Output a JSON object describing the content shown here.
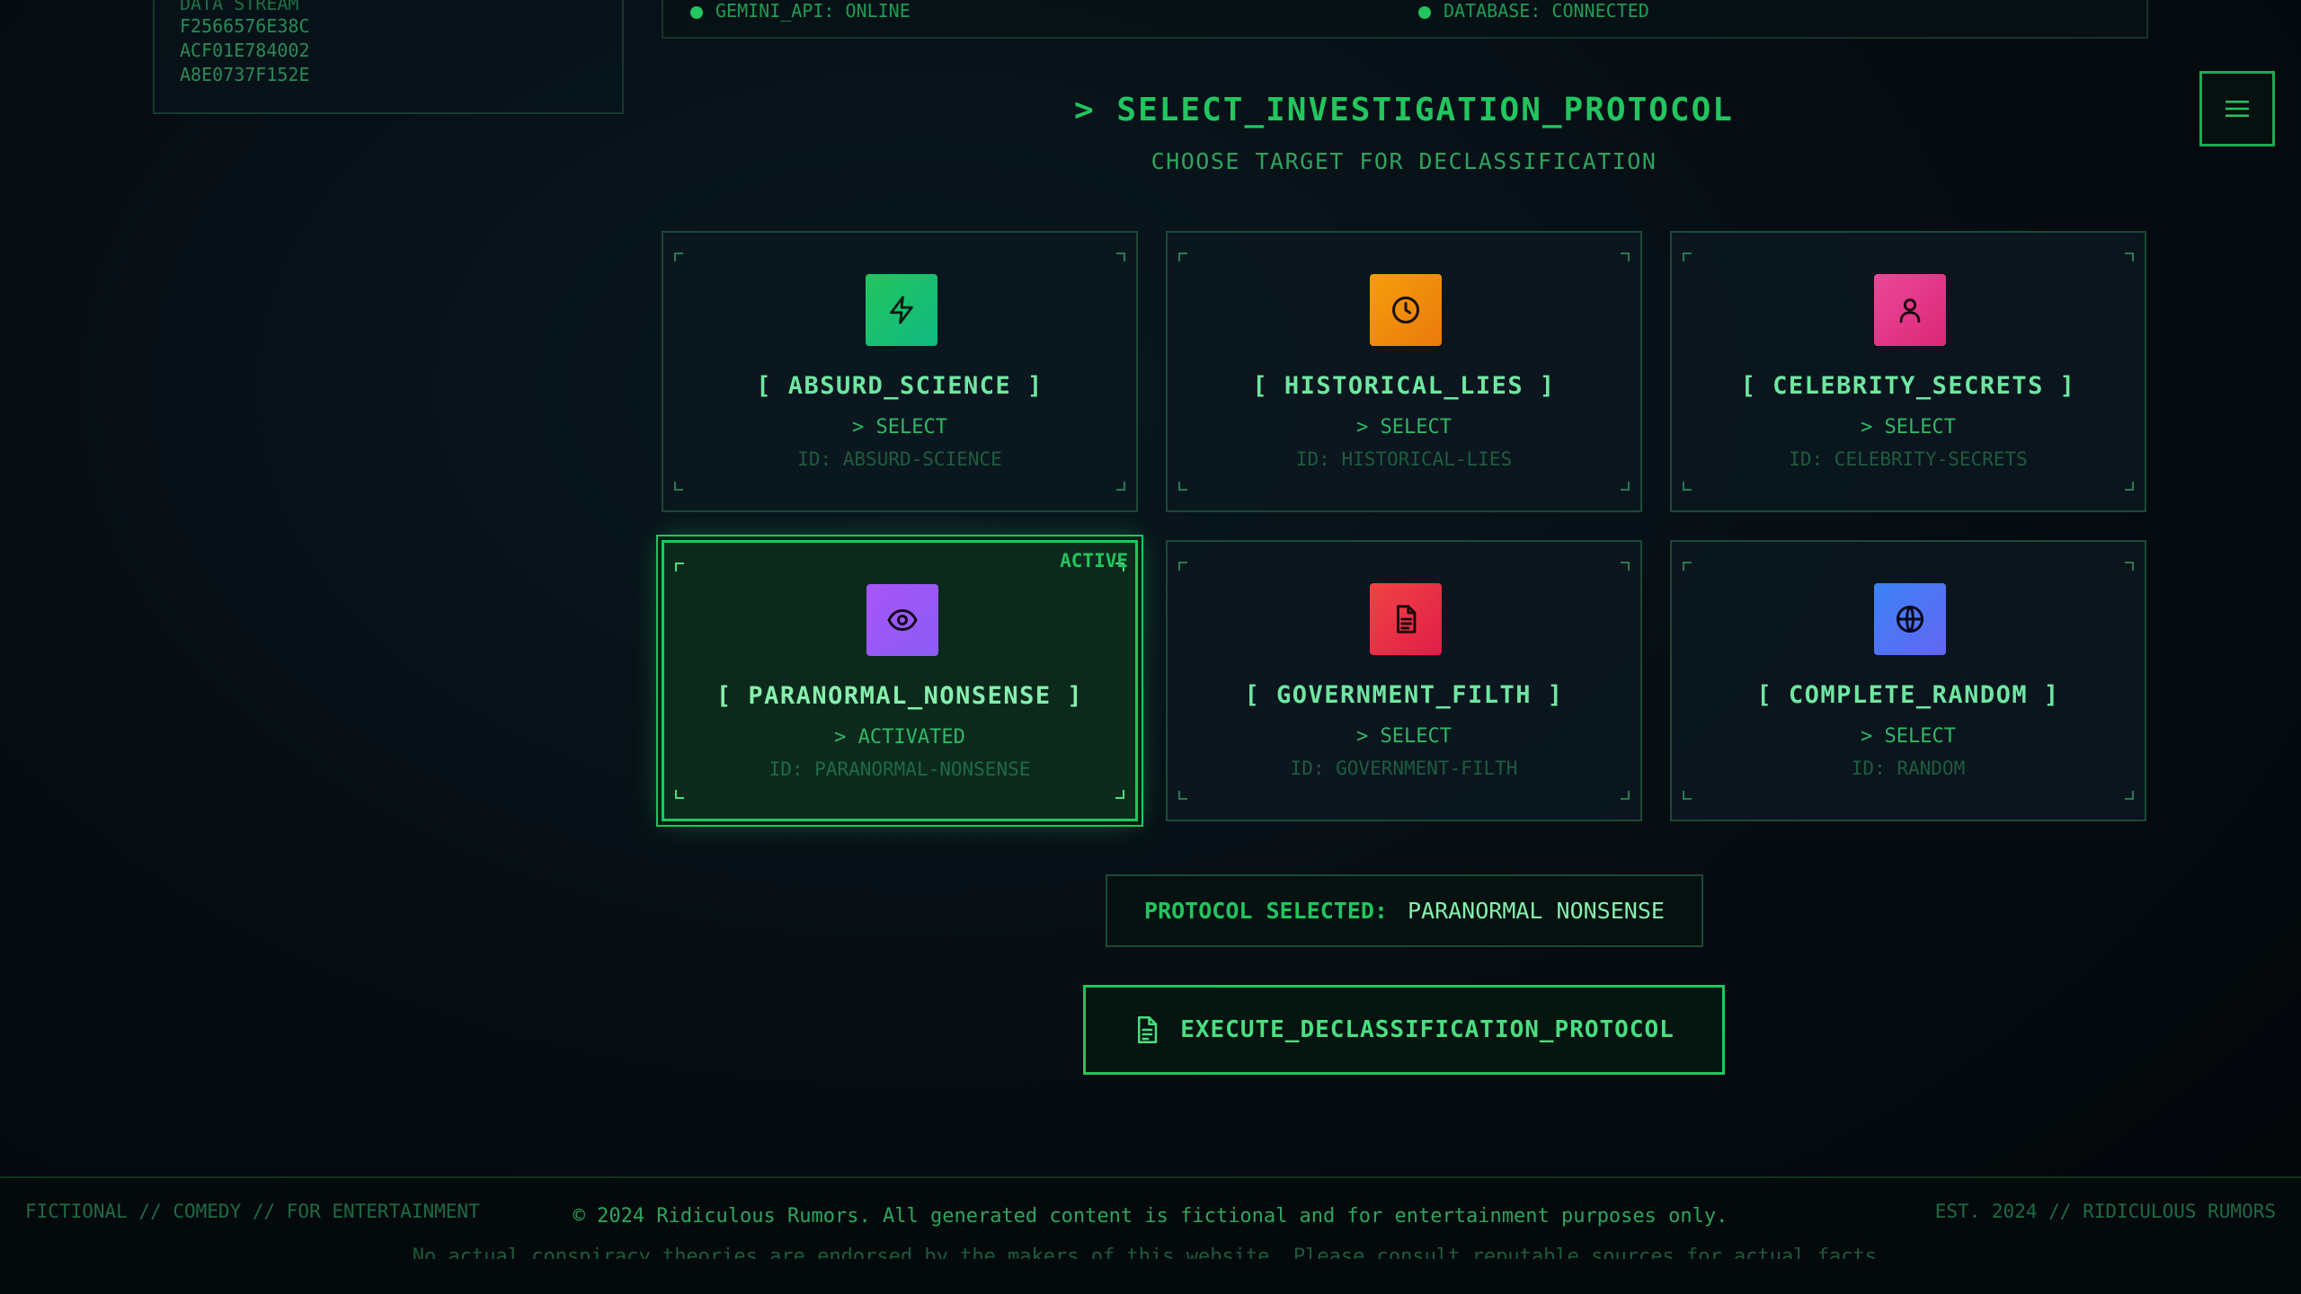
{
  "data_stream": {
    "title": "DATA STREAM",
    "lines": [
      "F2566576E38C",
      "ACF01E784002",
      "A8E0737F152E"
    ]
  },
  "status": {
    "left": "GEMINI_API: ONLINE",
    "right": "DATABASE: CONNECTED"
  },
  "menu": {
    "icon": "hamburger-menu-icon"
  },
  "heading": {
    "title": "> SELECT_INVESTIGATION_PROTOCOL",
    "subtitle": "CHOOSE TARGET FOR DECLASSIFICATION"
  },
  "cards": [
    {
      "title": "[ ABSURD_SCIENCE ]",
      "action": "> SELECT",
      "id": "ID: ABSURD-SCIENCE",
      "icon": "lightning-icon",
      "color": "#22c55e"
    },
    {
      "title": "[ HISTORICAL_LIES ]",
      "action": "> SELECT",
      "id": "ID: HISTORICAL-LIES",
      "icon": "clock-icon",
      "color": "#f59e0b"
    },
    {
      "title": "[ CELEBRITY_SECRETS ]",
      "action": "> SELECT",
      "id": "ID: CELEBRITY-SECRETS",
      "icon": "user-icon",
      "color": "#ec4899"
    },
    {
      "title": "[ PARANORMAL_NONSENSE ]",
      "action": "> ACTIVATED",
      "id": "ID: PARANORMAL-NONSENSE",
      "icon": "eye-icon",
      "color": "#a855f7",
      "badge": "ACTIVE"
    },
    {
      "title": "[ GOVERNMENT_FILTH ]",
      "action": "> SELECT",
      "id": "ID: GOVERNMENT-FILTH",
      "icon": "document-icon",
      "color": "#ef4444"
    },
    {
      "title": "[ COMPLETE_RANDOM ]",
      "action": "> SELECT",
      "id": "ID: RANDOM",
      "icon": "globe-icon",
      "color": "#3b82f6"
    }
  ],
  "selection": {
    "label": "PROTOCOL SELECTED:",
    "value": "PARANORMAL NONSENSE"
  },
  "execute": {
    "label": "EXECUTE_DECLASSIFICATION_PROTOCOL",
    "icon": "document-icon"
  },
  "footer": {
    "left": "FICTIONAL // COMEDY // FOR ENTERTAINMENT",
    "center": "© 2024 Ridiculous Rumors. All generated content is fictional and for entertainment purposes only.",
    "right": "EST. 2024 // RIDICULOUS RUMORS",
    "disclaimer": "No actual conspiracy theories are endorsed by the makers of this website. Please consult reputable sources for actual facts."
  },
  "colors": {
    "accent": "#22c55e",
    "background": "#050b10",
    "active_card": "#0b2a1c"
  }
}
